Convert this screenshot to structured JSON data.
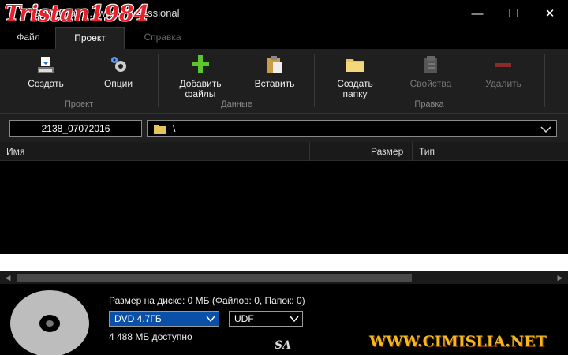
{
  "window": {
    "title": "ISO Образ - ...ware Professional",
    "controls": [
      "—",
      "☐",
      "✕"
    ]
  },
  "watermark": {
    "top_text": "Tristan1984",
    "site": "WWW.CIMISLIA.NET",
    "initials": "SA"
  },
  "tabs": [
    {
      "label": "Файл",
      "state": "normal"
    },
    {
      "label": "Проект",
      "state": "active"
    },
    {
      "label": "Справка",
      "state": "disabled"
    }
  ],
  "ribbon": {
    "buttons": {
      "create": "Создать",
      "options": "Опции",
      "add_files_1": "Добавить",
      "add_files_2": "файлы",
      "paste": "Вставить",
      "new_folder_1": "Создать",
      "new_folder_2": "папку",
      "properties": "Свойства",
      "delete": "Удалить"
    },
    "groups": {
      "project": "Проект",
      "data": "Данные",
      "edit": "Правка"
    }
  },
  "pathbar": {
    "project_name": "2138_07072016",
    "path": "\\"
  },
  "list": {
    "columns": {
      "name": "Имя",
      "size": "Размер",
      "type": "Тип"
    }
  },
  "status": {
    "disk_size": "Размер на диске: 0 МБ (Файлов: 0, Папок: 0)",
    "media": "DVD 4.7ГБ",
    "filesystem": "UDF",
    "available": "4 488 МБ доступно"
  },
  "colors": {
    "accent": "#0a4fa8",
    "background": "#000000",
    "ribbon": "#1f1f1f"
  }
}
